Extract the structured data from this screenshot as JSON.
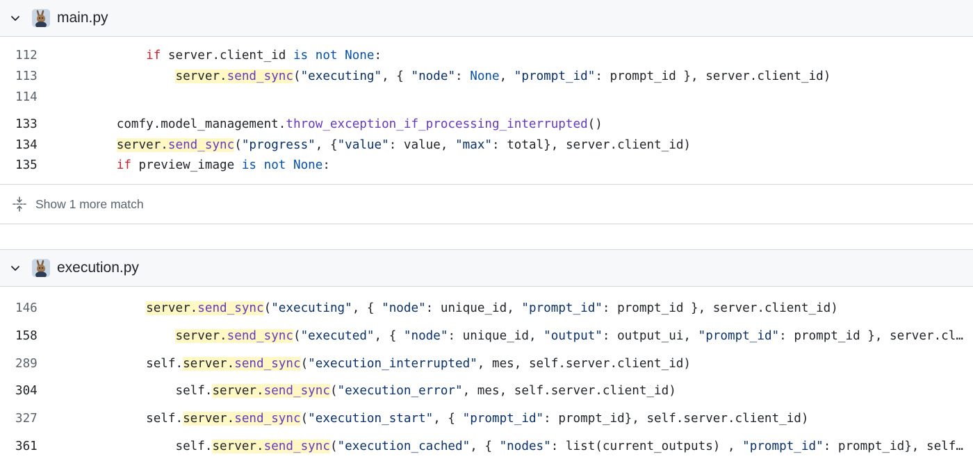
{
  "results": [
    {
      "file_name": "main.py",
      "collapse_icon": "chevron-down-icon",
      "avatar_icon": "repo-avatar-icon",
      "lines": [
        {
          "number": "112",
          "segments": [
            {
              "t": "            "
            },
            {
              "t": "if",
              "c": "kw"
            },
            {
              "t": " server.client_id "
            },
            {
              "t": "is not",
              "c": "kw2"
            },
            {
              "t": " "
            },
            {
              "t": "None",
              "c": "kw2"
            },
            {
              "t": ":"
            }
          ]
        },
        {
          "number": "113",
          "segments": [
            {
              "t": "                "
            },
            {
              "t": "server.",
              "h": true
            },
            {
              "t": "send_sync",
              "c": "fn",
              "h": true
            },
            {
              "t": "("
            },
            {
              "t": "\"executing\"",
              "c": "st"
            },
            {
              "t": ", { "
            },
            {
              "t": "\"node\"",
              "c": "st"
            },
            {
              "t": ": "
            },
            {
              "t": "None",
              "c": "kw2"
            },
            {
              "t": ", "
            },
            {
              "t": "\"prompt_id\"",
              "c": "st"
            },
            {
              "t": ": prompt_id }, server.client_id)"
            }
          ]
        },
        {
          "number": "114",
          "segments": []
        },
        {
          "number": "133",
          "segments": [
            {
              "t": "        comfy.model_management."
            },
            {
              "t": "throw_exception_if_processing_interrupted",
              "c": "fn"
            },
            {
              "t": "()"
            }
          ]
        },
        {
          "number": "134",
          "segments": [
            {
              "t": "        "
            },
            {
              "t": "server.",
              "h": true
            },
            {
              "t": "send_sync",
              "c": "fn",
              "h": true
            },
            {
              "t": "("
            },
            {
              "t": "\"progress\"",
              "c": "st"
            },
            {
              "t": ", {"
            },
            {
              "t": "\"value\"",
              "c": "st"
            },
            {
              "t": ": value, "
            },
            {
              "t": "\"max\"",
              "c": "st"
            },
            {
              "t": ": total}, server.client_id)"
            }
          ]
        },
        {
          "number": "135",
          "segments": [
            {
              "t": "        "
            },
            {
              "t": "if",
              "c": "kw"
            },
            {
              "t": " preview_image "
            },
            {
              "t": "is not",
              "c": "kw2"
            },
            {
              "t": " "
            },
            {
              "t": "None",
              "c": "kw2"
            },
            {
              "t": ":"
            }
          ]
        }
      ],
      "more_label": "Show 1 more match",
      "more_icon": "unfold-icon"
    },
    {
      "file_name": "execution.py",
      "collapse_icon": "chevron-down-icon",
      "avatar_icon": "repo-avatar-icon",
      "lines": [
        {
          "number": "146",
          "segments": [
            {
              "t": "            "
            },
            {
              "t": "server.",
              "h": true
            },
            {
              "t": "send_sync",
              "c": "fn",
              "h": true
            },
            {
              "t": "("
            },
            {
              "t": "\"executing\"",
              "c": "st"
            },
            {
              "t": ", { "
            },
            {
              "t": "\"node\"",
              "c": "st"
            },
            {
              "t": ": unique_id, "
            },
            {
              "t": "\"prompt_id\"",
              "c": "st"
            },
            {
              "t": ": prompt_id }, server.client_id)"
            }
          ]
        },
        {
          "number": "158",
          "segments": [
            {
              "t": "                "
            },
            {
              "t": "server.",
              "h": true
            },
            {
              "t": "send_sync",
              "c": "fn",
              "h": true
            },
            {
              "t": "("
            },
            {
              "t": "\"executed\"",
              "c": "st"
            },
            {
              "t": ", { "
            },
            {
              "t": "\"node\"",
              "c": "st"
            },
            {
              "t": ": unique_id, "
            },
            {
              "t": "\"output\"",
              "c": "st"
            },
            {
              "t": ": output_ui, "
            },
            {
              "t": "\"prompt_id\"",
              "c": "st"
            },
            {
              "t": ": prompt_id }, server.client_id)"
            }
          ]
        },
        {
          "number": "289",
          "segments": [
            {
              "t": "            self."
            },
            {
              "t": "server.",
              "h": true
            },
            {
              "t": "send_sync",
              "c": "fn",
              "h": true
            },
            {
              "t": "("
            },
            {
              "t": "\"execution_interrupted\"",
              "c": "st"
            },
            {
              "t": ", mes, self.server.client_id)"
            }
          ]
        },
        {
          "number": "304",
          "segments": [
            {
              "t": "                self."
            },
            {
              "t": "server.",
              "h": true
            },
            {
              "t": "send_sync",
              "c": "fn",
              "h": true
            },
            {
              "t": "("
            },
            {
              "t": "\"execution_error\"",
              "c": "st"
            },
            {
              "t": ", mes, self.server.client_id)"
            }
          ]
        },
        {
          "number": "327",
          "segments": [
            {
              "t": "            self."
            },
            {
              "t": "server.",
              "h": true
            },
            {
              "t": "send_sync",
              "c": "fn",
              "h": true
            },
            {
              "t": "("
            },
            {
              "t": "\"execution_start\"",
              "c": "st"
            },
            {
              "t": ", { "
            },
            {
              "t": "\"prompt_id\"",
              "c": "st"
            },
            {
              "t": ": prompt_id}, self.server.client_id)"
            }
          ]
        },
        {
          "number": "361",
          "segments": [
            {
              "t": "                self."
            },
            {
              "t": "server.",
              "h": true
            },
            {
              "t": "send_sync",
              "c": "fn",
              "h": true
            },
            {
              "t": "("
            },
            {
              "t": "\"execution_cached\"",
              "c": "st"
            },
            {
              "t": ", { "
            },
            {
              "t": "\"nodes\"",
              "c": "st"
            },
            {
              "t": ": list(current_outputs) , "
            },
            {
              "t": "\"prompt_id\"",
              "c": "st"
            },
            {
              "t": ": prompt_id}, self.server.client_id)"
            }
          ]
        }
      ]
    }
  ],
  "colors": {
    "match_highlight": "#fff8c5",
    "keyword": "#cf222e",
    "constant": "#0550ae",
    "string": "#0a3069",
    "function": "#6639ba",
    "header_background": "#f6f8fa"
  }
}
